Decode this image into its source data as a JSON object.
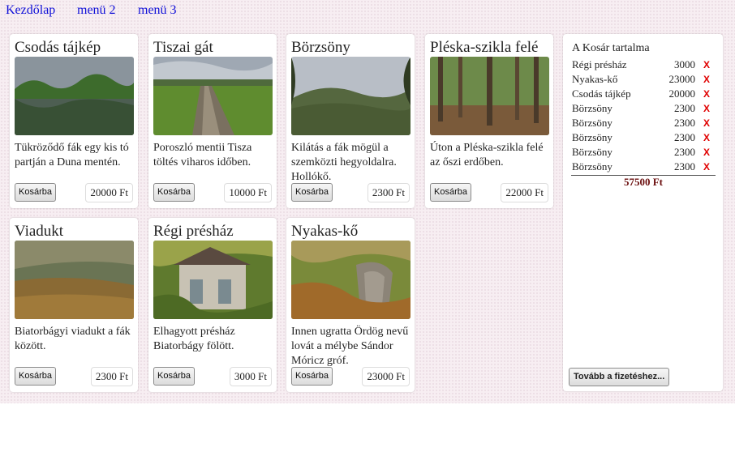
{
  "nav": {
    "home": "Kezdőlap",
    "menu2": "menü 2",
    "menu3": "menü 3"
  },
  "products": [
    {
      "title": "Csodás tájkép",
      "desc": "Tükröződő fák egy kis tó partján a Duna mentén.",
      "button": "Kosárba",
      "price": "20000 Ft",
      "image": "forest-lake-photo"
    },
    {
      "title": "Tiszai gát",
      "desc": "Poroszló mentii Tisza töltés viharos időben.",
      "button": "Kosárba",
      "price": "10000 Ft",
      "image": "levee-road-photo"
    },
    {
      "title": "Börzsöny",
      "desc": "Kilátás a fák mögül a szemközti hegyoldalra. Hollókő.",
      "button": "Kosárba",
      "price": "2300 Ft",
      "image": "mountain-view-photo"
    },
    {
      "title": "Pléska-szikla felé",
      "desc": "Úton a Pléska-szikla felé az őszi erdőben.",
      "button": "Kosárba",
      "price": "22000 Ft",
      "image": "autumn-forest-photo"
    },
    {
      "title": "Viadukt",
      "desc": "Biatorbágyi viadukt a fák között.",
      "button": "Kosárba",
      "price": "2300 Ft",
      "image": "viaduct-photo"
    },
    {
      "title": "Régi présház",
      "desc": "Elhagyott présház Biatorbágy fölött.",
      "button": "Kosárba",
      "price": "3000 Ft",
      "image": "old-press-house-photo"
    },
    {
      "title": "Nyakas-kő",
      "desc": "Innen ugratta Ördög nevű lovát a mélybe Sándor Móricz gróf.",
      "button": "Kosárba",
      "price": "23000 Ft",
      "image": "rock-formation-photo"
    }
  ],
  "cart": {
    "title": "A Kosár tartalma",
    "items": [
      {
        "name": "Régi présház",
        "price": "3000",
        "remove": "X"
      },
      {
        "name": "Nyakas-kő",
        "price": "23000",
        "remove": "X"
      },
      {
        "name": "Csodás tájkép",
        "price": "20000",
        "remove": "X"
      },
      {
        "name": "Börzsöny",
        "price": "2300",
        "remove": "X"
      },
      {
        "name": "Börzsöny",
        "price": "2300",
        "remove": "X"
      },
      {
        "name": "Börzsöny",
        "price": "2300",
        "remove": "X"
      },
      {
        "name": "Börzsöny",
        "price": "2300",
        "remove": "X"
      },
      {
        "name": "Börzsöny",
        "price": "2300",
        "remove": "X"
      }
    ],
    "total": "57500 Ft",
    "checkout": "Tovább a fizetéshez..."
  },
  "colors": {
    "page_bg": "#f7eef2",
    "nav_link": "#1010d8",
    "remove_x": "#e00000",
    "total": "#6b0f0f"
  }
}
